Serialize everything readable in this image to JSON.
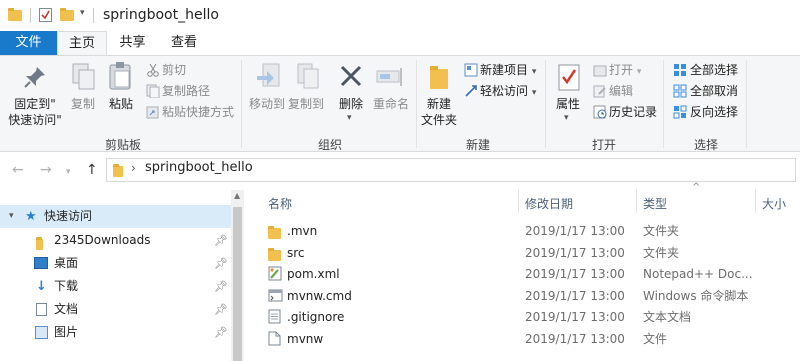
{
  "window": {
    "title": "springboot_hello"
  },
  "tabs": [
    {
      "label": "文件"
    },
    {
      "label": "主页"
    },
    {
      "label": "共享"
    },
    {
      "label": "查看"
    }
  ],
  "ribbon": {
    "clipboard": {
      "group_label": "剪贴板",
      "pin_label_1": "固定到\"",
      "pin_label_2": "快速访问\"",
      "copy_label": "复制",
      "paste_label": "粘贴",
      "cut_label": "剪切",
      "copy_path_label": "复制路径",
      "paste_shortcut_label": "粘贴快捷方式"
    },
    "organize": {
      "group_label": "组织",
      "move_to_label": "移动到",
      "copy_to_label": "复制到",
      "delete_label": "删除",
      "rename_label": "重命名"
    },
    "new": {
      "group_label": "新建",
      "new_folder_label_1": "新建",
      "new_folder_label_2": "文件夹",
      "new_item_label": "新建项目",
      "easy_access_label": "轻松访问"
    },
    "open": {
      "group_label": "打开",
      "properties_label": "属性",
      "open_label": "打开",
      "edit_label": "编辑",
      "history_label": "历史记录"
    },
    "select": {
      "group_label": "选择",
      "select_all_label": "全部选择",
      "select_none_label": "全部取消",
      "invert_label": "反向选择"
    }
  },
  "address": {
    "path": "springboot_hello"
  },
  "nav": {
    "items": [
      {
        "label": "快速访问",
        "icon": "star-icon",
        "pinned": false
      },
      {
        "label": "2345Downloads",
        "icon": "folder-icon",
        "pinned": true
      },
      {
        "label": "桌面",
        "icon": "desktop-icon",
        "pinned": true
      },
      {
        "label": "下载",
        "icon": "download-icon",
        "pinned": true
      },
      {
        "label": "文档",
        "icon": "document-icon",
        "pinned": true
      },
      {
        "label": "图片",
        "icon": "picture-icon",
        "pinned": true
      }
    ]
  },
  "columns": {
    "name": "名称",
    "date": "修改日期",
    "type": "类型",
    "size": "大小"
  },
  "files": [
    {
      "name": ".mvn",
      "date": "2019/1/17 13:00",
      "type": "文件夹",
      "icon": "folder-icon"
    },
    {
      "name": "src",
      "date": "2019/1/17 13:00",
      "type": "文件夹",
      "icon": "folder-icon"
    },
    {
      "name": "pom.xml",
      "date": "2019/1/17 13:00",
      "type": "Notepad++ Doc...",
      "icon": "notepadpp-file-icon"
    },
    {
      "name": "mvnw.cmd",
      "date": "2019/1/17 13:00",
      "type": "Windows 命令脚本",
      "icon": "cmd-script-icon"
    },
    {
      "name": ".gitignore",
      "date": "2019/1/17 13:00",
      "type": "文本文档",
      "icon": "text-file-icon"
    },
    {
      "name": "mvnw",
      "date": "2019/1/17 13:00",
      "type": "文件",
      "icon": "blank-file-icon"
    }
  ],
  "colors": {
    "file_tab": "#1979ca",
    "selection": "#d9ebf9",
    "folder": "#f2c04f"
  }
}
